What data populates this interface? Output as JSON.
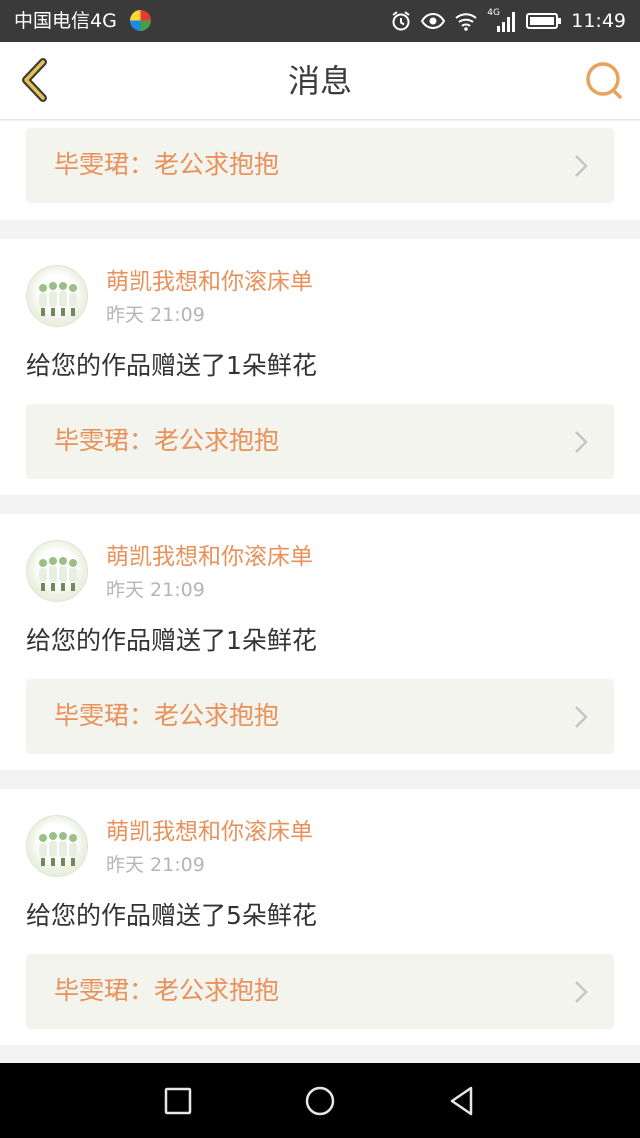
{
  "status_bar": {
    "carrier": "中国电信4G",
    "network_badge": "4G",
    "time": "11:49",
    "icons": [
      "alarm-icon",
      "eye-icon",
      "wifi-icon",
      "signal-icon",
      "battery-icon"
    ]
  },
  "header": {
    "title": "消息",
    "back_icon": "chevron-left-icon",
    "search_icon": "search-icon",
    "accent_color": "#e8a25a"
  },
  "messages": [
    {
      "sender": "",
      "time": "",
      "text": "",
      "work_title": "毕雯珺：老公求抱抱"
    },
    {
      "sender": "萌凯我想和你滚床单",
      "time": "昨天 21:09",
      "text": "给您的作品赠送了1朵鲜花",
      "work_title": "毕雯珺：老公求抱抱"
    },
    {
      "sender": "萌凯我想和你滚床单",
      "time": "昨天 21:09",
      "text": "给您的作品赠送了1朵鲜花",
      "work_title": "毕雯珺：老公求抱抱"
    },
    {
      "sender": "萌凯我想和你滚床单",
      "time": "昨天 21:09",
      "text": "给您的作品赠送了5朵鲜花",
      "work_title": "毕雯珺：老公求抱抱"
    }
  ],
  "system_nav": {
    "icons": [
      "square-icon",
      "circle-icon",
      "triangle-back-icon"
    ]
  },
  "colors": {
    "accent": "#e8915a",
    "status_bar": "#3a3a3a",
    "work_row_bg": "#f4f4ee",
    "page_bg": "#f3f3f3"
  }
}
